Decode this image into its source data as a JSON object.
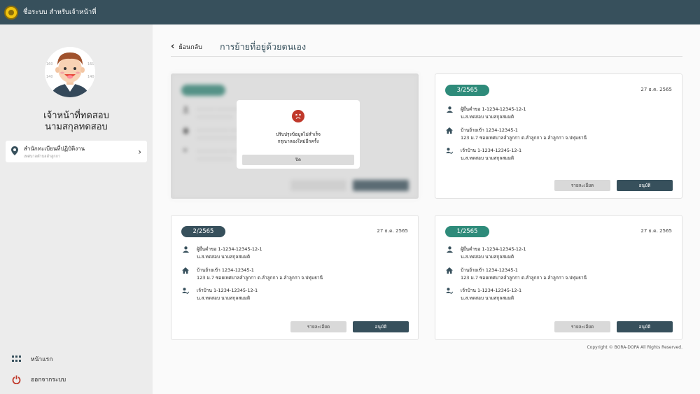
{
  "header": {
    "title": "ชื่อระบบ สำหรับเจ้าหน้าที่"
  },
  "user": {
    "first_name": "เจ้าหน้าที่ทดสอบ",
    "last_name": "นามสกุลทดสอบ"
  },
  "office": {
    "title": "สำนักทะเบียนที่ปฏิบัติงาน",
    "subtitle": "เทศบาลตำบลลำลูกกา"
  },
  "nav": {
    "home": "หน้าแรก",
    "logout": "ออกจากระบบ"
  },
  "page": {
    "back_label": "ย้อนกลับ",
    "title": "การย้ายที่อยู่ด้วยตนเอง"
  },
  "cards": [
    {
      "badge": "3/2565",
      "date": "27 ธ.ค. 2565",
      "applicant_label": "ผู้ยื่นคำขอ",
      "applicant_id": "1-1234-12345-12-1",
      "applicant_name": "น.ส.ทดสอบ นามสกุลสมมติ",
      "house_label": "บ้านย้ายเข้า",
      "house_id": "1234-12345-1",
      "house_address": "123 ม.7 ซอยเทศบาลลำลูกกา ต.ลำลูกกา อ.ลำลูกกา จ.ปทุมธานี",
      "owner_label": "เจ้าบ้าน",
      "owner_id": "1-1234-12345-12-1",
      "owner_name": "น.ส.ทดสอบ นามสกุลสมมติ",
      "detail_btn": "รายละเอียด",
      "approve_btn": "อนุมัติ"
    },
    {
      "badge": "2/2565",
      "date": "27 ธ.ค. 2565",
      "applicant_label": "ผู้ยื่นคำขอ",
      "applicant_id": "1-1234-12345-12-1",
      "applicant_name": "น.ส.ทดสอบ นามสกุลสมมติ",
      "house_label": "บ้านย้ายเข้า",
      "house_id": "1234-12345-1",
      "house_address": "123 ม.7 ซอยเทศบาลลำลูกกา ต.ลำลูกกา อ.ลำลูกกา จ.ปทุมธานี",
      "owner_label": "เจ้าบ้าน",
      "owner_id": "1-1234-12345-12-1",
      "owner_name": "น.ส.ทดสอบ นามสกุลสมมติ",
      "detail_btn": "รายละเอียด",
      "approve_btn": "อนุมัติ"
    },
    {
      "badge": "1/2565",
      "date": "27 ธ.ค. 2565",
      "applicant_label": "ผู้ยื่นคำขอ",
      "applicant_id": "1-1234-12345-12-1",
      "applicant_name": "น.ส.ทดสอบ นามสกุลสมมติ",
      "house_label": "บ้านย้ายเข้า",
      "house_id": "1234-12345-1",
      "house_address": "123 ม.7 ซอยเทศบาลลำลูกกา ต.ลำลูกกา อ.ลำลูกกา จ.ปทุมธานี",
      "owner_label": "เจ้าบ้าน",
      "owner_id": "1-1234-12345-12-1",
      "owner_name": "น.ส.ทดสอบ นามสกุลสมมติ",
      "detail_btn": "รายละเอียด",
      "approve_btn": "อนุมัติ"
    }
  ],
  "modal": {
    "line1": "ปรับปรุงข้อมูลไม่สำเร็จ",
    "line2": "กรุณาลองใหม่อีกครั้ง",
    "close": "ปิด"
  },
  "footer": {
    "copyright": "Copyright © BORA-DOPA All Rights Reserved."
  },
  "colors": {
    "primary": "#37505c",
    "badge_blue": "#37505c",
    "badge_teal": "#2e8b7a",
    "error": "#c0392b"
  },
  "icons": {
    "back": "chevron-left-icon",
    "office": "location-pin-icon",
    "home": "grid-icon",
    "logout": "power-icon",
    "applicant": "person-icon",
    "house": "house-icon",
    "owner": "person-check-icon",
    "error": "sad-face-icon"
  }
}
